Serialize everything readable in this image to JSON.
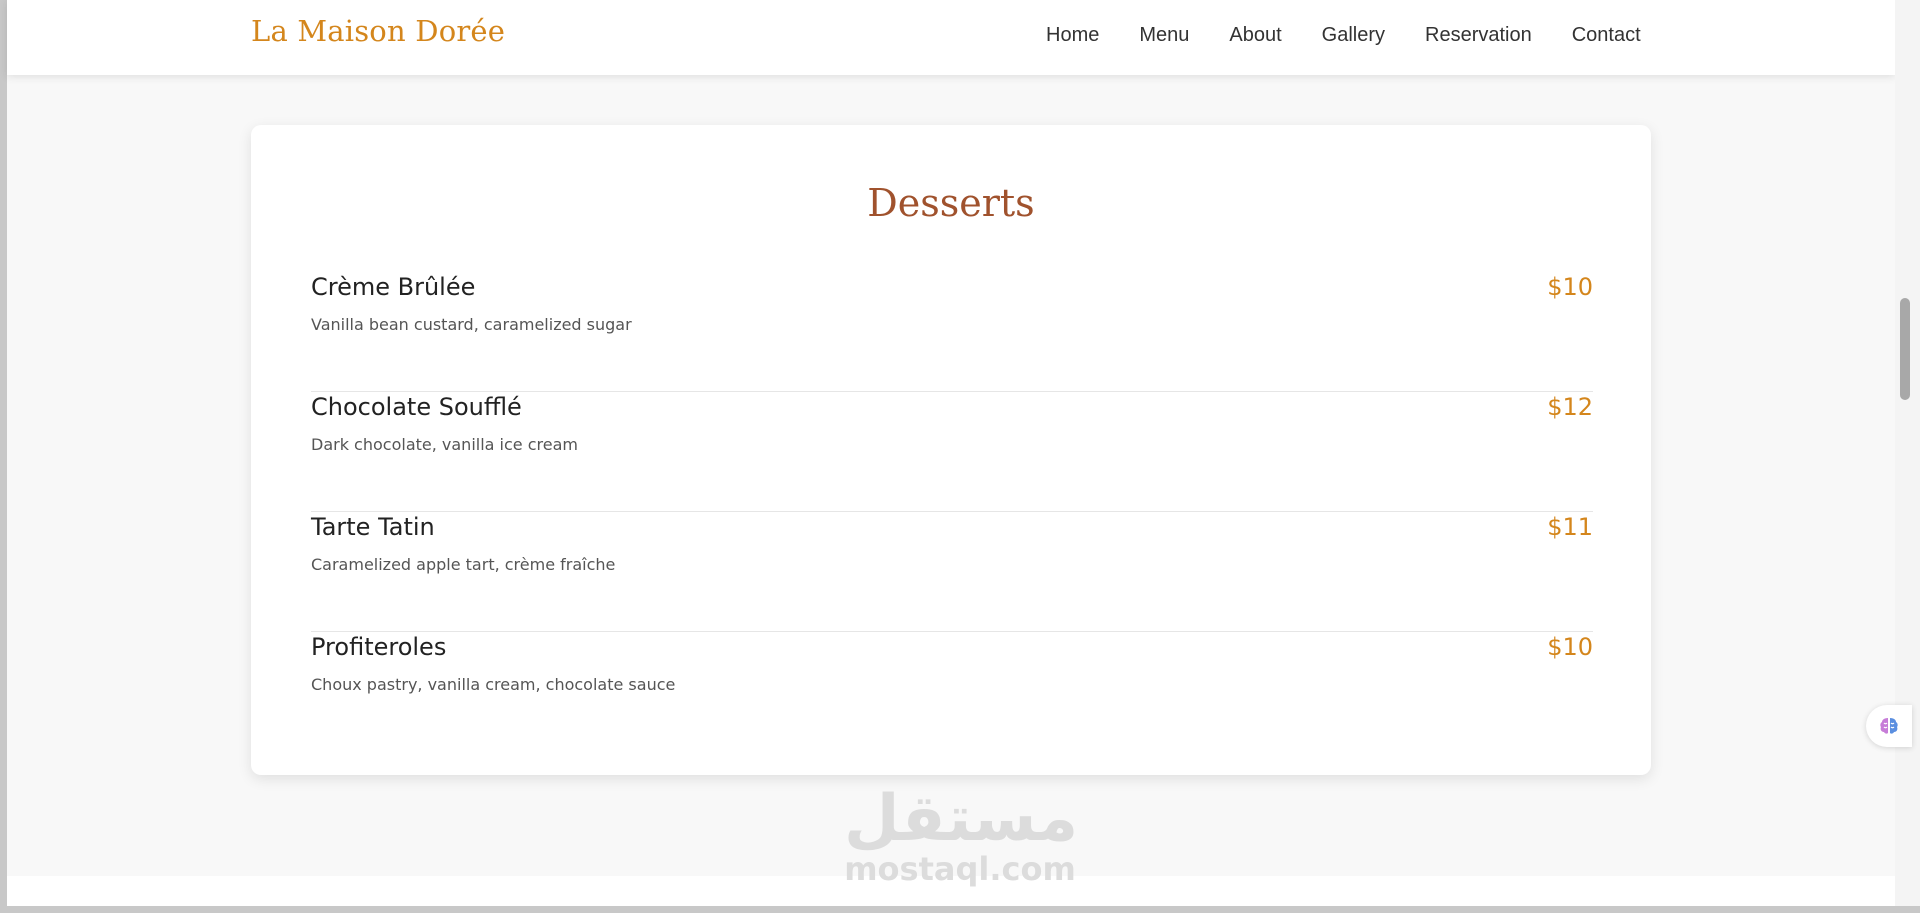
{
  "navbar": {
    "brand": "La Maison Dorée",
    "links": [
      "Home",
      "Menu",
      "About",
      "Gallery",
      "Reservation",
      "Contact"
    ]
  },
  "section": {
    "title": "Desserts",
    "items": [
      {
        "name": "Crème Brûlée",
        "description": "Vanilla bean custard, caramelized sugar",
        "price": "$10"
      },
      {
        "name": "Chocolate Soufflé",
        "description": "Dark chocolate, vanilla ice cream",
        "price": "$12"
      },
      {
        "name": "Tarte Tatin",
        "description": "Caramelized apple tart, crème fraîche",
        "price": "$11"
      },
      {
        "name": "Profiteroles",
        "description": "Choux pastry, vanilla cream, chocolate sauce",
        "price": "$10"
      }
    ]
  },
  "watermark": {
    "arabic": "مستقل",
    "latin": "mostaql.com"
  },
  "icons": {
    "floating_button": "brain-icon"
  },
  "colors": {
    "brand": "#d4861c",
    "section_title": "#a0522d",
    "price": "#d4861c",
    "background": "#f8f8f8"
  }
}
